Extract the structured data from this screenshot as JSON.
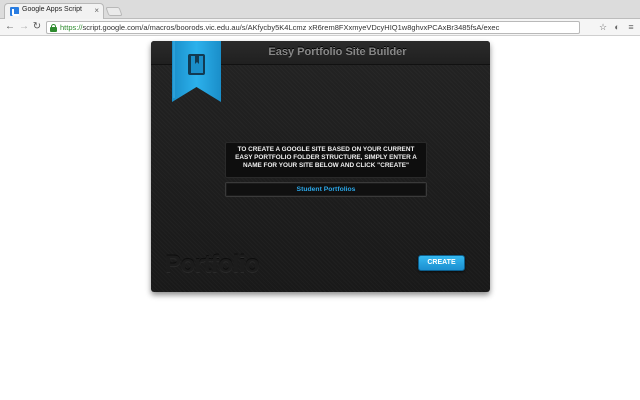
{
  "browser": {
    "tab_title": "Google Apps Script",
    "tab_close": "×",
    "nav": {
      "back": "←",
      "forward": "→",
      "reload": "↻"
    },
    "url_scheme": "https://",
    "url_rest": "script.google.com/a/macros/boorods.vic.edu.au/s/AKfycby5K4Lcmz xR6rem8FXxmyeVDcyHIQ1w8ghvxPCAxBr3485fsA/exec",
    "toolbar_icons": [
      "star-icon",
      "extension-icon",
      "menu-icon"
    ]
  },
  "app": {
    "title": "Easy Portfolio Site Builder",
    "instructions": "TO CREATE A GOOGLE SITE BASED ON YOUR CURRENT EASY PORTFOLIO FOLDER STRUCTURE, SIMPLY ENTER A NAME FOR YOUR SITE BELOW AND CLICK \"CREATE\"",
    "site_name_value": "Student Portfolios",
    "watermark": "Portfolio",
    "create_label": "CREATE",
    "accent_color": "#29a8e0"
  }
}
